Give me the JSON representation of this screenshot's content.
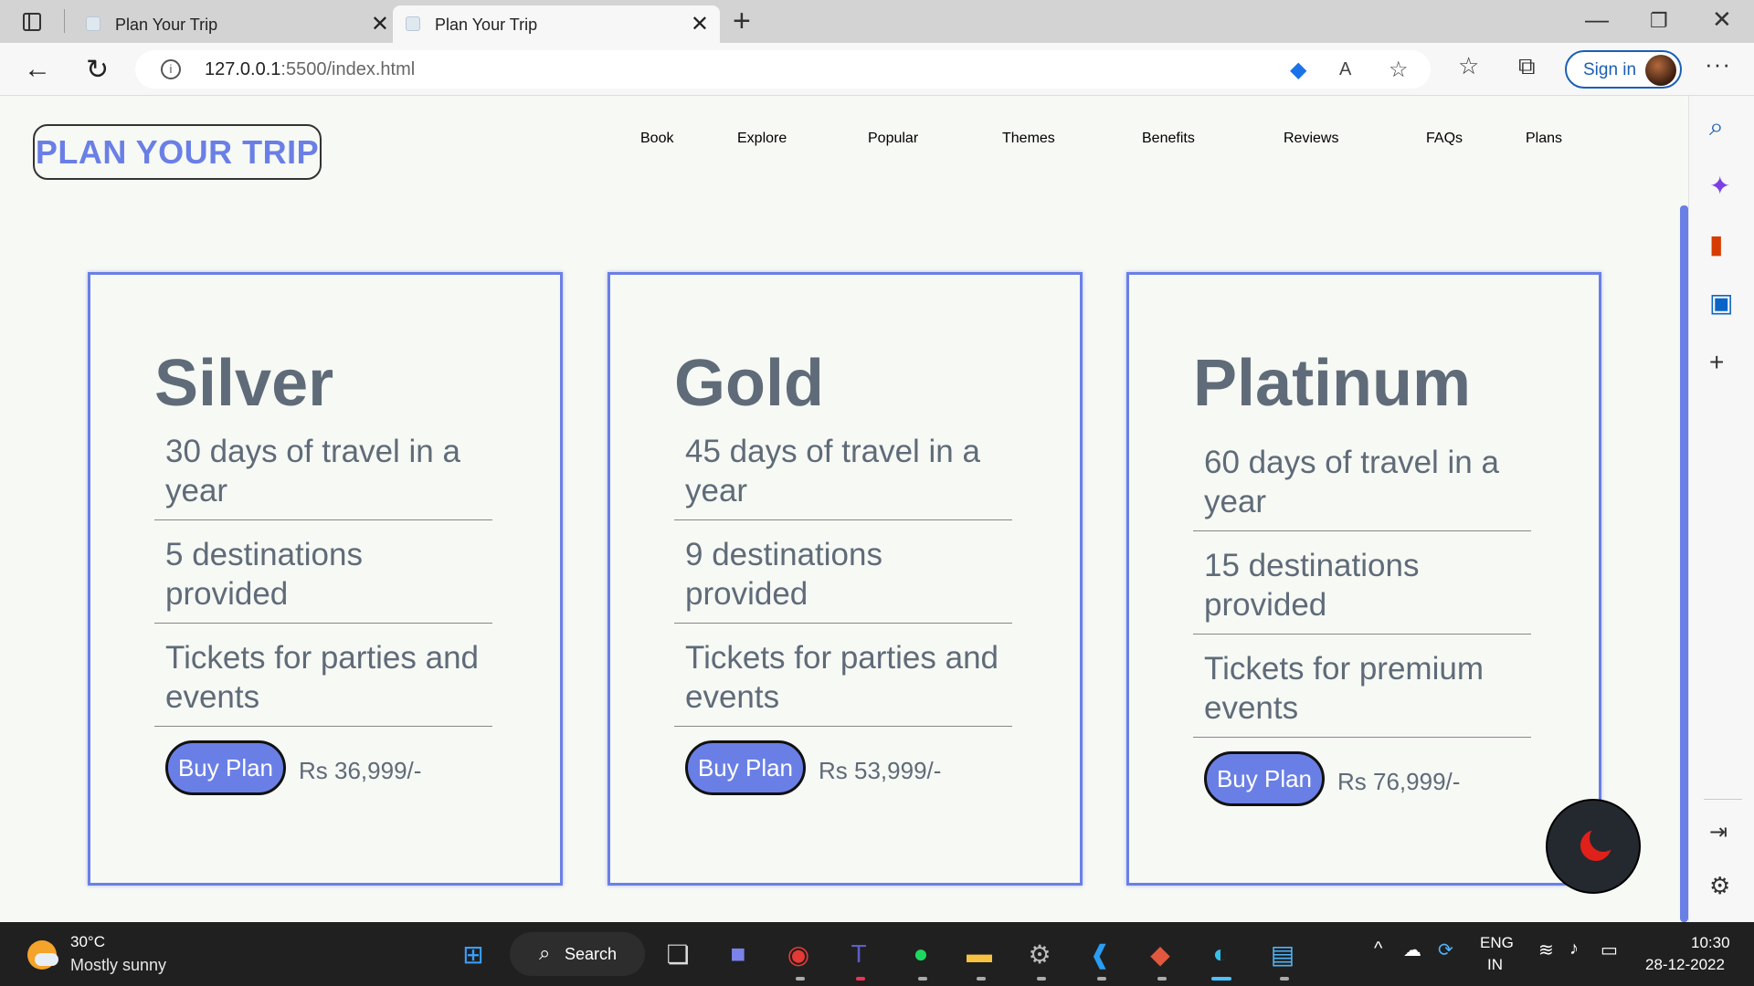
{
  "browser": {
    "tabs": [
      {
        "title": "Plan Your Trip"
      },
      {
        "title": "Plan Your Trip"
      }
    ],
    "url_host": "127.0.0.1",
    "url_rest": ":5500/index.html",
    "sign_in_label": "Sign in"
  },
  "site": {
    "logo": "PLAN YOUR TRIP",
    "nav": [
      "Book",
      "Explore",
      "Popular",
      "Themes",
      "Benefits",
      "Reviews",
      "FAQs",
      "Plans"
    ]
  },
  "plans": [
    {
      "name": "Silver",
      "features": [
        "30 days of travel in a year",
        "5 destinations provided",
        "Tickets for parties and events"
      ],
      "button": "Buy Plan",
      "price": "Rs 36,999/-"
    },
    {
      "name": "Gold",
      "features": [
        "45 days of travel in a year",
        "9 destinations provided",
        "Tickets for parties and events"
      ],
      "button": "Buy Plan",
      "price": "Rs 53,999/-"
    },
    {
      "name": "Platinum",
      "features": [
        "60 days of travel in a year",
        "15 destinations provided",
        "Tickets for premium events"
      ],
      "button": "Buy Plan",
      "price": "Rs 76,999/-"
    }
  ],
  "taskbar": {
    "temperature": "30°C",
    "weather": "Mostly sunny",
    "search_label": "Search",
    "lang_top": "ENG",
    "lang_bottom": "IN",
    "time": "10:30",
    "date": "28-12-2022"
  },
  "colors": {
    "accent": "#6a7fe6",
    "text": "#5f6b78",
    "page_bg": "#f7f9f5",
    "moon": "#e0201a"
  }
}
